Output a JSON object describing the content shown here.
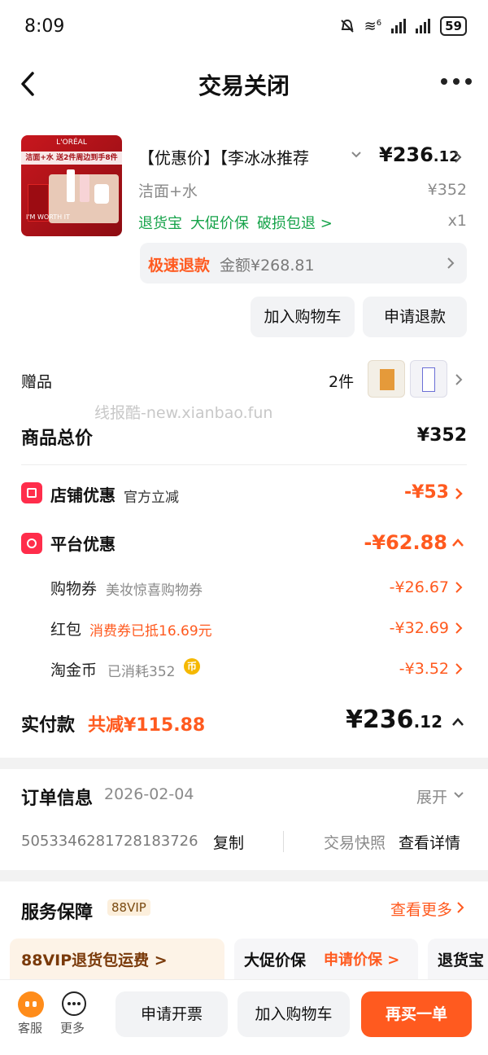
{
  "status_bar": {
    "time": "8:09",
    "wifi_label": "6",
    "battery": "59"
  },
  "nav": {
    "title": "交易关闭"
  },
  "product": {
    "image_caption": "洁面+水 送2件周边到手8件",
    "brand": "L'ORÉAL",
    "image_tag": "I'M WORTH IT",
    "title": "【优惠价】【李冰冰推荐",
    "price_main": "¥236",
    "price_cents": ".12",
    "spec": "洁面+水",
    "original_price": "¥352",
    "tags": [
      "退货宝",
      "大促价保",
      "破损包退 >"
    ],
    "qty": "x1"
  },
  "refund_bar": {
    "label": "极速退款",
    "amount": "金额¥268.81"
  },
  "actions": {
    "add_cart": "加入购物车",
    "apply_refund": "申请退款"
  },
  "gift": {
    "label": "赠品",
    "count": "2件"
  },
  "watermark": "线报酷-new.xianbao.fun",
  "totals": {
    "label": "商品总价",
    "value": "¥352"
  },
  "shop_discount": {
    "label": "店铺优惠",
    "sub": "官方立减",
    "value": "-¥53"
  },
  "platform_discount": {
    "label": "平台优惠",
    "value": "-¥62.88"
  },
  "sub_discounts": {
    "coupon": {
      "label": "购物券",
      "note": "美妆惊喜购物券",
      "value": "-¥26.67"
    },
    "hongbao": {
      "label": "红包",
      "note": "消费券已抵16.69元",
      "value": "-¥32.69"
    },
    "coin": {
      "label": "淘金币",
      "note": "已消耗352",
      "coin_glyph": "币",
      "value": "-¥3.52"
    }
  },
  "paid": {
    "label": "实付款",
    "saved": "共减¥115.88",
    "value_main": "¥236",
    "value_cents": ".12"
  },
  "order": {
    "title": "订单信息",
    "date": "2026-02-04",
    "expand": "展开",
    "number": "5053346281728183726",
    "copy": "复制",
    "snapshot": "交易快照",
    "detail": "查看详情"
  },
  "service": {
    "title": "服务保障",
    "badge": "88VIP",
    "more": "查看更多",
    "cards": [
      "88VIP退货包运费 >",
      "大促价保",
      "申请价保 >",
      "退货宝"
    ]
  },
  "bottom": {
    "kefu": "客服",
    "more": "更多",
    "invoice": "申请开票",
    "add_cart": "加入购物车",
    "rebuy": "再买一单"
  },
  "colors": {
    "accent": "#ff5a1f",
    "green": "#16a34a",
    "badge_red": "#ff2d4b"
  }
}
